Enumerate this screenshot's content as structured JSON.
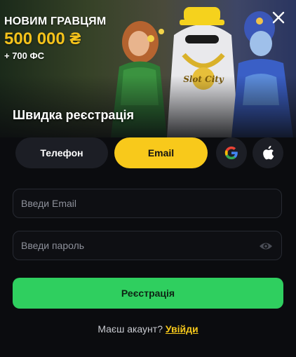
{
  "banner": {
    "promo_line1": "НОВИМ ГРАВЦЯМ",
    "promo_line2": "500 000 ₴",
    "promo_line3": "+ 700 ФС",
    "title": "Швидка реєстрація",
    "logo_text": "Slot City"
  },
  "methods": {
    "phone_label": "Телефон",
    "email_label": "Email",
    "active": "Email",
    "social": [
      "google-icon",
      "apple-icon"
    ]
  },
  "form": {
    "email_placeholder": "Введи Email",
    "password_placeholder": "Введи пароль",
    "submit_label": "Реєстрація"
  },
  "login": {
    "prompt": "Маєш акаунт?",
    "link_label": "Увійди"
  },
  "colors": {
    "accent": "#f8c91b",
    "submit": "#2fcf5f",
    "background": "#0b0c0f",
    "pill": "#1c1e25"
  }
}
